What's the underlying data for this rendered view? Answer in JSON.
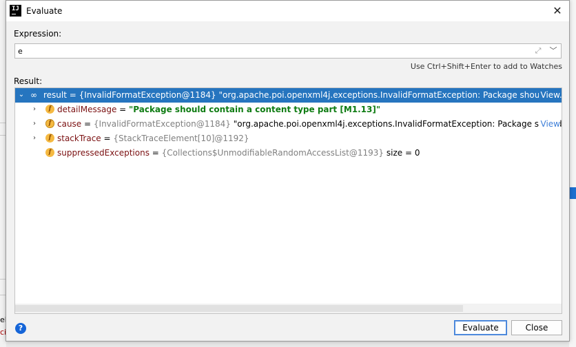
{
  "window": {
    "title": "Evaluate",
    "app_icon_text": "IJ"
  },
  "expression": {
    "label": "Expression:",
    "value": "e"
  },
  "hint": "Use Ctrl+Shift+Enter to add to Watches",
  "result": {
    "label": "Result:",
    "rows": [
      {
        "name": "result",
        "eq": " = ",
        "type_ref": "{InvalidFormatException@1184}",
        "value": " \"org.apache.poi.openxml4j.exceptions.InvalidFormatException: Package should co...",
        "link": "View"
      },
      {
        "icon": "f",
        "name": "detailMessage",
        "eq": " = ",
        "value": "\"Package should contain a content type part [M1.13]\""
      },
      {
        "icon": "f",
        "name": "cause",
        "eq": " = ",
        "type_ref": "{InvalidFormatException@1184}",
        "value": " \"org.apache.poi.openxml4j.exceptions.InvalidFormatException: Package should",
        "link": "View"
      },
      {
        "icon": "f",
        "name": "stackTrace",
        "eq": " = ",
        "type_ref": "{StackTraceElement[10]@1192}"
      },
      {
        "icon": "f",
        "name": "suppressedExceptions",
        "eq": " = ",
        "type_ref": "{Collections$UnmodifiableRandomAccessList@1193}",
        "value": "  size = 0"
      }
    ]
  },
  "buttons": {
    "help": "?",
    "evaluate": "Evaluate",
    "close": "Close"
  },
  "background": {
    "left_fragment_1": "ell",
    "left_fragment_2": "ci"
  },
  "colors": {
    "selection": "#2675bf",
    "string_value": "#0f7c13",
    "field_name": "#7a0f10",
    "link": "#3c7ed8"
  }
}
